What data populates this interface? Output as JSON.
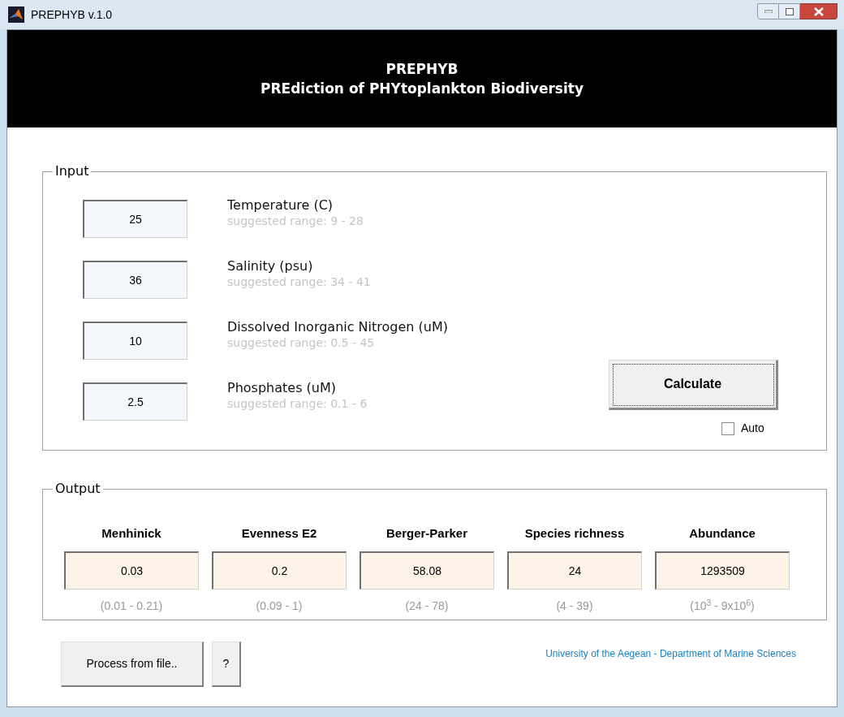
{
  "window": {
    "title": "PREPHYB v.1.0"
  },
  "header": {
    "title": "PREPHYB",
    "subtitle": "PREdiction of PHYtoplankton Biodiversity"
  },
  "input": {
    "legend": "Input",
    "fields": [
      {
        "value": "25",
        "label": "Temperature (C)",
        "hint": "suggested range: 9 - 28"
      },
      {
        "value": "36",
        "label": "Salinity (psu)",
        "hint": "suggested range: 34 - 41"
      },
      {
        "value": "10",
        "label": "Dissolved Inorganic Nitrogen (uM)",
        "hint": "suggested range: 0.5 - 45"
      },
      {
        "value": "2.5",
        "label": "Phosphates (uM)",
        "hint": "suggested range: 0.1 - 6"
      }
    ],
    "calculate_button": "Calculate",
    "auto": {
      "label": "Auto",
      "checked": false
    }
  },
  "output": {
    "legend": "Output",
    "columns": [
      {
        "name": "Menhinick",
        "value": "0.03",
        "range": "(0.01 - 0.21)"
      },
      {
        "name": "Evenness E2",
        "value": "0.2",
        "range": "(0.09 - 1)"
      },
      {
        "name": "Berger-Parker",
        "value": "58.08",
        "range": "(24 - 78)"
      },
      {
        "name": "Species richness",
        "value": "24",
        "range": "(4 - 39)"
      },
      {
        "name": "Abundance",
        "value": "1293509",
        "range": "(10$^{3}$ - 9x10$^{6}$)"
      }
    ]
  },
  "buttons": [
    "Process from file..",
    "?"
  ],
  "credit": "University of the Aegean - Department of Marine Sciences"
}
